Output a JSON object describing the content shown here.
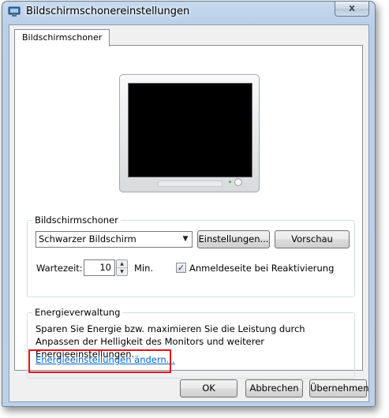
{
  "window": {
    "title": "Bildschirmschonereinstellungen",
    "close_label": "x"
  },
  "tabs": [
    {
      "label": "Bildschirmschoner",
      "active": true
    }
  ],
  "screensaver_group": {
    "label": "Bildschirmschoner",
    "selected": "Schwarzer Bildschirm",
    "settings_button": "Einstellungen...",
    "preview_button": "Vorschau",
    "wait_label": "Wartezeit:",
    "wait_value": "10",
    "wait_unit": "Min.",
    "resume_checkbox_label": "Anmeldeseite bei Reaktivierung",
    "resume_checked": true
  },
  "power_group": {
    "label": "Energieverwaltung",
    "description": "Sparen Sie Energie bzw. maximieren Sie die Leistung durch Anpassen der Helligkeit des Monitors und weiterer Energieeinstellungen.",
    "link": "Energieeinstellungen ändern..."
  },
  "footer": {
    "ok": "OK",
    "cancel": "Abbrechen",
    "apply": "Übernehmen"
  },
  "colors": {
    "link": "#0066cc",
    "highlight": "#e0141b",
    "monitor_screen": "#000000"
  }
}
